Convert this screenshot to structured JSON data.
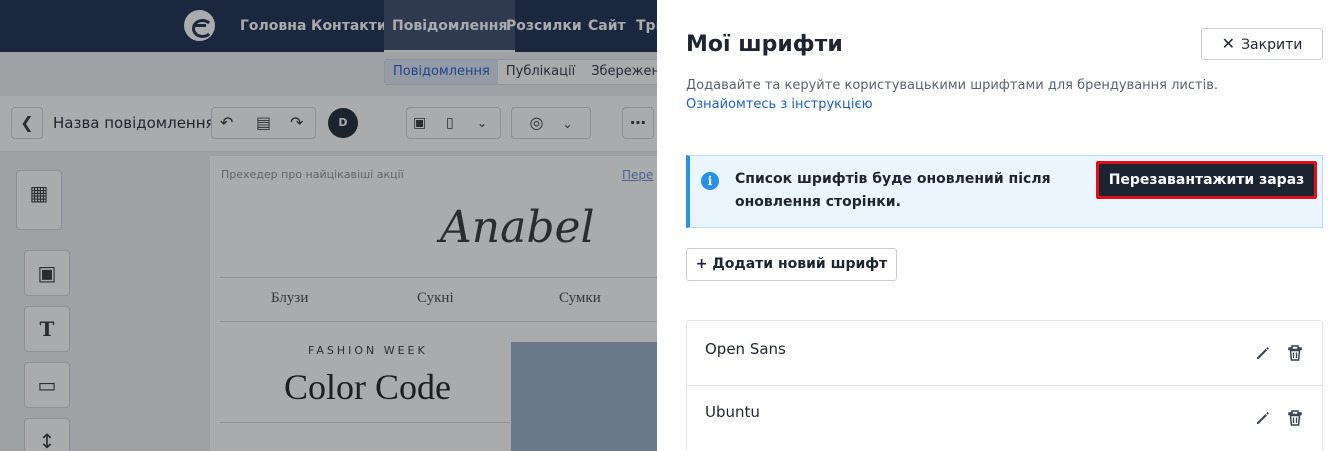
{
  "nav": {
    "items": [
      "Головна",
      "Контакти",
      "Повідомлення",
      "Розсилки",
      "Сайт",
      "Три"
    ]
  },
  "subtabs": [
    "Повідомлення",
    "Публікації",
    "Збережені ш"
  ],
  "toolbar": {
    "title": "Назва повідомлення",
    "avatar_letter": "D"
  },
  "canvas": {
    "preheader": "Прехедер про найцікавіші акції",
    "prelink": "Пере",
    "brand": "Anabel",
    "menu": [
      "Блузи",
      "Сукні",
      "Сумки"
    ],
    "kicker": "FASHION WEEK",
    "headline": "Color Code"
  },
  "panel": {
    "title": "Мої шрифти",
    "close_label": "Закрити",
    "description": "Додавайте та керуйте користувацькими шрифтами для брендування листів.",
    "guide_link": "Ознайомтесь з інструкцією",
    "info_text": "Список шрифтів буде оновлений після оновлення сторінки.",
    "reload_label": "Перезавантажити зараз",
    "add_label": "+ Додати новий шрифт",
    "fonts": [
      "Open Sans",
      "Ubuntu"
    ]
  },
  "colors": {
    "nav_bg": "#1b2a4e",
    "accent_blue": "#2891e8",
    "link": "#1f5cc4",
    "dark_button": "#1b2430",
    "highlight_border": "#e0101a"
  }
}
